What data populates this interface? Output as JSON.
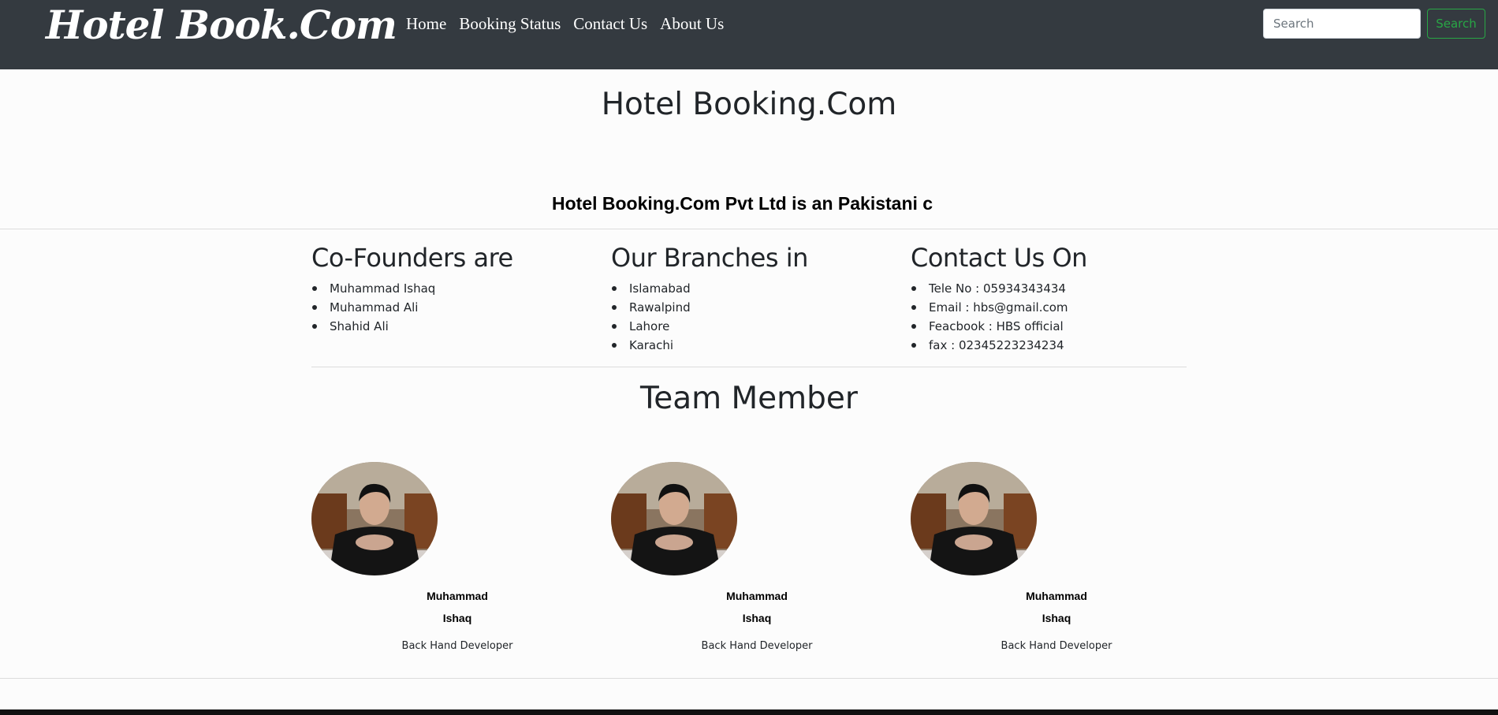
{
  "navbar": {
    "brand": "Hotel Book.Com",
    "links": [
      "Home",
      "Booking Status",
      "Contact Us",
      "About Us"
    ],
    "search_placeholder": "Search",
    "search_button": "Search"
  },
  "hero": {
    "title": "Hotel Booking.Com",
    "marquee_text": "Hotel Booking.Com Pvt Ltd is an Pakistani c"
  },
  "columns": {
    "founders": {
      "heading": "Co-Founders are",
      "items": [
        "Muhammad Ishaq",
        "Muhammad Ali",
        "Shahid Ali"
      ]
    },
    "branches": {
      "heading": "Our Branches in",
      "items": [
        "Islamabad",
        "Rawalpind",
        "Lahore",
        "Karachi"
      ]
    },
    "contact": {
      "heading": "Contact Us On",
      "items": [
        "Tele No : 05934343434",
        "Email : hbs@gmail.com",
        "Feacbook : HBS official",
        "fax : 02345223234234"
      ]
    }
  },
  "team": {
    "title": "Team Member",
    "members": [
      {
        "name_line1": "Muhammad",
        "name_line2": "Ishaq",
        "role": "Back Hand Developer"
      },
      {
        "name_line1": "Muhammad",
        "name_line2": "Ishaq",
        "role": "Back Hand Developer"
      },
      {
        "name_line1": "Muhammad",
        "name_line2": "Ishaq",
        "role": "Back Hand Developer"
      }
    ]
  },
  "colors": {
    "navbar_bg": "#343a40",
    "search_button": "#28a745",
    "page_bg": "#fcfcfc"
  }
}
